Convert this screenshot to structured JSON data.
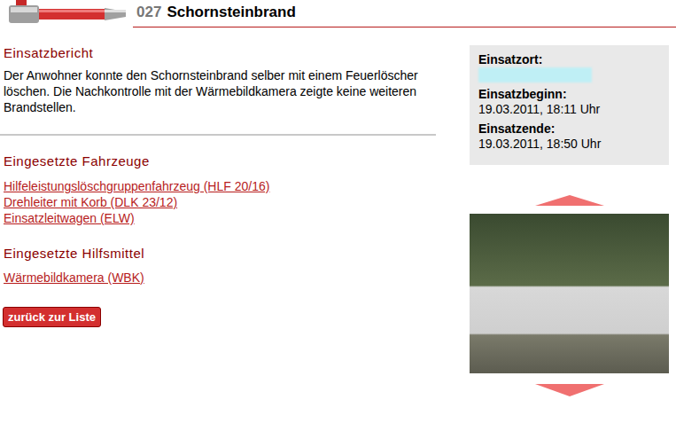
{
  "header": {
    "number": "027",
    "title": "Schornsteinbrand"
  },
  "report": {
    "heading": "Einsatzbericht",
    "text": "Der Anwohner konnte den Schornsteinbrand selber mit einem Feuerlöscher löschen. Die Nachkontrolle mit der Wärmebildkamera zeigte keine weiteren Brandstellen."
  },
  "vehicles": {
    "heading": "Eingesetzte Fahrzeuge",
    "items": [
      "Hilfeleistungslöschgruppenfahrzeug (HLF 20/16)",
      "Drehleiter mit Korb (DLK 23/12)",
      "Einsatzleitwagen (ELW)"
    ]
  },
  "equipment": {
    "heading": "Eingesetzte Hilfsmittel",
    "items": [
      "Wärmebildkamera (WBK)"
    ]
  },
  "back_button": "zurück zur Liste",
  "info": [
    {
      "label": "Einsatzort:",
      "kind": "redacted",
      "value": ""
    },
    {
      "label": "Einsatzbeginn:",
      "kind": "text",
      "value": "19.03.2011, 18:11 Uhr"
    },
    {
      "label": "Einsatzende:",
      "kind": "text",
      "value": "19.03.2011, 18:50 Uhr"
    }
  ]
}
